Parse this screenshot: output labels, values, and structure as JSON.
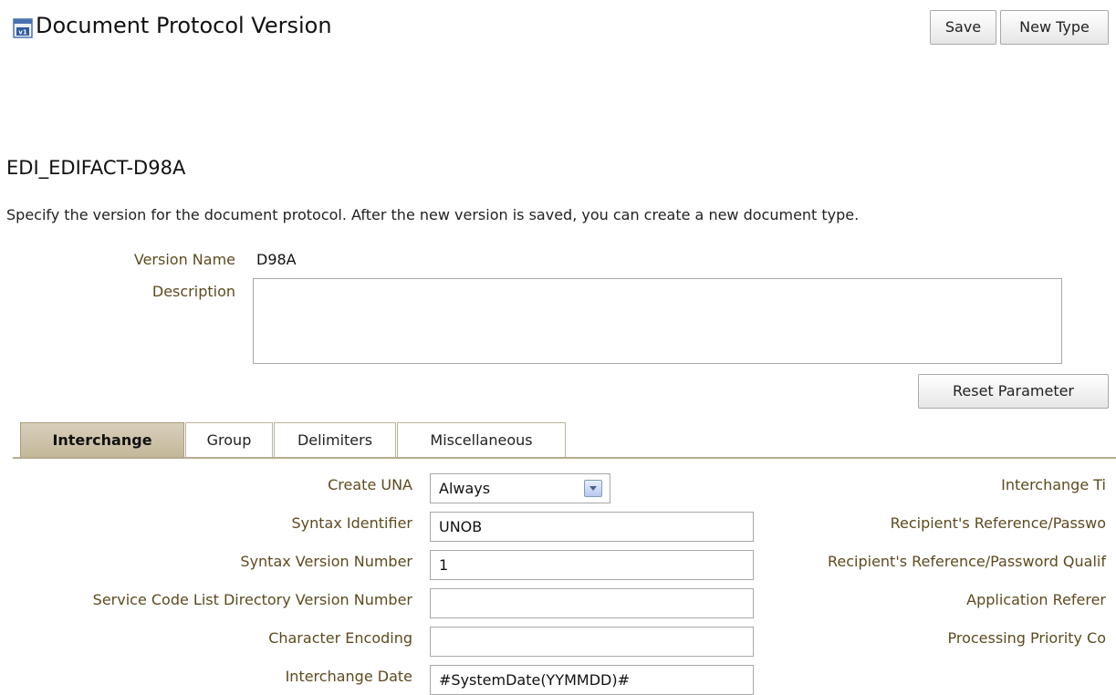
{
  "header": {
    "title": "Document Protocol Version",
    "icon": "document-version-icon",
    "save_label": "Save",
    "new_type_label": "New Type"
  },
  "section": {
    "title": "EDI_EDIFACT-D98A",
    "instruction": "Specify the version for the document protocol. After the new version is saved, you can create a new document type."
  },
  "form": {
    "version_name_label": "Version Name",
    "version_name_value": "D98A",
    "description_label": "Description",
    "description_value": "",
    "reset_label": "Reset Parameter"
  },
  "tabs": [
    "Interchange",
    "Group",
    "Delimiters",
    "Miscellaneous"
  ],
  "selected_tab": "Interchange",
  "interchange": {
    "left_fields": [
      {
        "label": "Create UNA",
        "value": "Always",
        "type": "select"
      },
      {
        "label": "Syntax Identifier",
        "value": "UNOB",
        "type": "text"
      },
      {
        "label": "Syntax Version Number",
        "value": "1",
        "type": "text"
      },
      {
        "label": "Service Code List Directory Version Number",
        "value": "",
        "type": "text"
      },
      {
        "label": "Character Encoding",
        "value": "",
        "type": "text"
      },
      {
        "label": "Interchange Date",
        "value": "#SystemDate(YYMMDD)#",
        "type": "text"
      }
    ],
    "right_labels": [
      "Interchange Ti",
      "Recipient's Reference/Passwo",
      "Recipient's Reference/Password Qualif",
      "Application Referer",
      "Processing Priority Co"
    ]
  }
}
